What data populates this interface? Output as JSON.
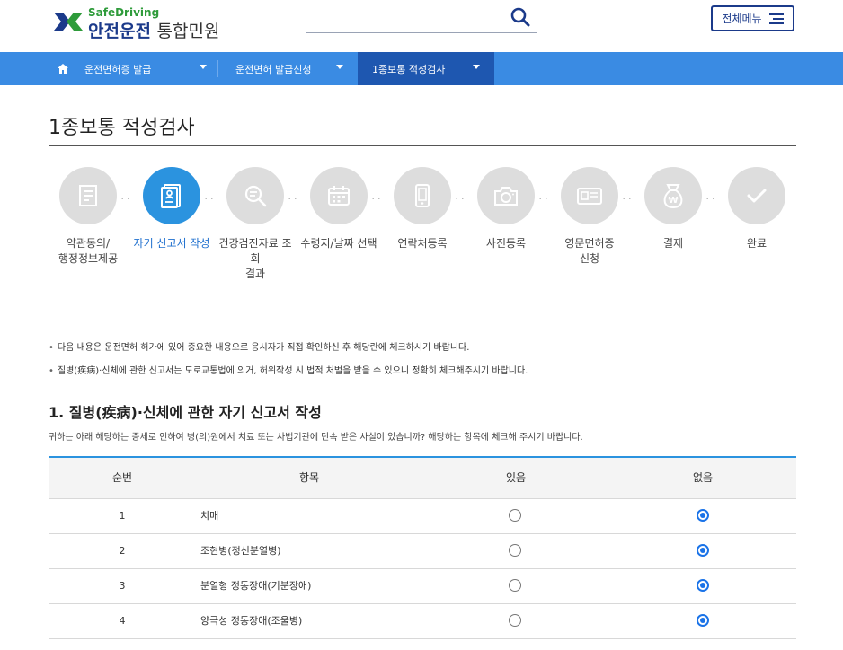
{
  "header": {
    "logo_small": "SafeDriving",
    "logo_bold": "안전운전",
    "logo_thin": "통합민원",
    "menu_label": "전체메뉴"
  },
  "nav": {
    "items": [
      "운전면허증 발급",
      "운전면허 발급신청",
      "1종보통 적성검사"
    ]
  },
  "page_title": "1종보통 적성검사",
  "steps": [
    {
      "label": "약관동의/\n행정정보제공",
      "icon": "document-icon",
      "active": false
    },
    {
      "label": "자기 신고서 작성",
      "icon": "id-card-icon",
      "active": true
    },
    {
      "label": "건강검진자료 조회\n결과",
      "icon": "magnifier-icon",
      "active": false
    },
    {
      "label": "수령지/날짜 선택",
      "icon": "calendar-icon",
      "active": false
    },
    {
      "label": "연락처등록",
      "icon": "phone-icon",
      "active": false
    },
    {
      "label": "사진등록",
      "icon": "camera-icon",
      "active": false
    },
    {
      "label": "영문면허증\n신청",
      "icon": "license-card-icon",
      "active": false
    },
    {
      "label": "결제",
      "icon": "money-bag-icon",
      "active": false
    },
    {
      "label": "완료",
      "icon": "check-icon",
      "active": false
    }
  ],
  "notes": [
    "다음 내용은 운전면허 허가에 있어 중요한 내용으로 응시자가 직접 확인하신 후 해당란에 체크하시기 바랍니다.",
    "질병(疾病)·신체에 관한 신고서는 도로교통법에 의거, 허위작성 시 법적 처벌을 받을 수 있으니 정확히 체크해주시기 바랍니다."
  ],
  "section": {
    "title": "1. 질병(疾病)·신체에 관한 자기 신고서 작성",
    "desc": "귀하는 아래 해당하는 증세로 인하여 병(의)원에서 치료 또는 사법기관에 단속 받은 사실이 있습니까? 해당하는 항목에 체크해 주시기 바랍니다."
  },
  "table": {
    "headers": [
      "순번",
      "항목",
      "있음",
      "없음"
    ],
    "rows": [
      {
        "no": "1",
        "item": "치매",
        "answer": "없음"
      },
      {
        "no": "2",
        "item": "조현병(정신분열병)",
        "answer": "없음"
      },
      {
        "no": "3",
        "item": "분열형 정동장애(기분장애)",
        "answer": "없음"
      },
      {
        "no": "4",
        "item": "양극성 정동장애(조울병)",
        "answer": "없음"
      }
    ]
  },
  "colors": {
    "nav_bg": "#3a8be3",
    "nav_active": "#1e57b0",
    "accent": "#2b93df",
    "brand_blue": "#1b3a8a",
    "brand_green": "#2e9b3a"
  }
}
